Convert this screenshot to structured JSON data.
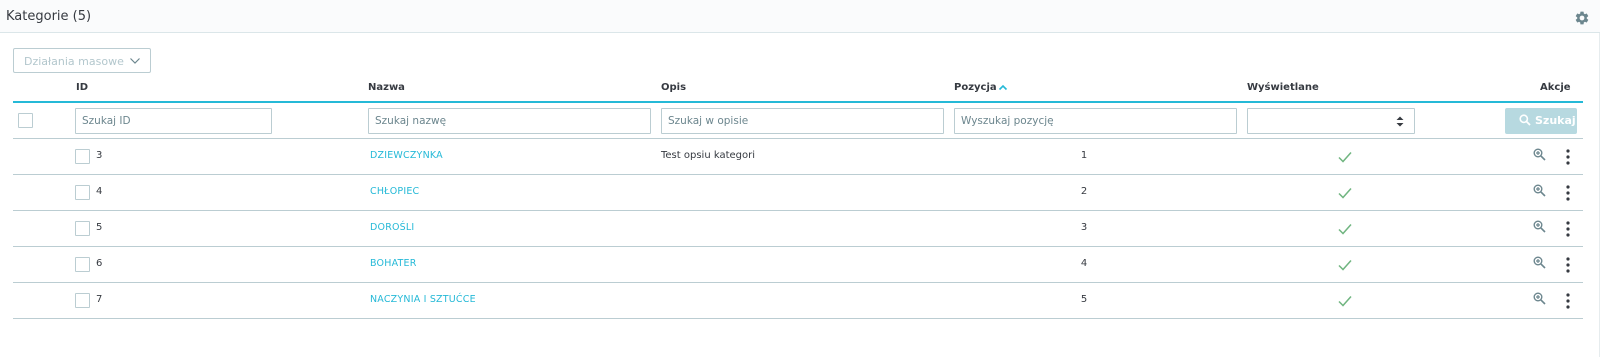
{
  "header": {
    "title": "Kategorie (5)",
    "settings_icon": "gear-icon"
  },
  "bulk_actions": {
    "label": "Działania masowe",
    "icon": "chevron-down-icon"
  },
  "table": {
    "columns": {
      "id": "ID",
      "name": "Nazwa",
      "description": "Opis",
      "position": "Pozycja",
      "displayed": "Wyświetlane",
      "actions": "Akcje"
    },
    "sort": {
      "column": "position",
      "direction": "ascending",
      "icon": "sort-up-icon"
    },
    "filters": {
      "id_placeholder": "Szukaj ID",
      "name_placeholder": "Szukaj nazwę",
      "description_placeholder": "Szukaj w opisie",
      "position_placeholder": "Wyszukaj pozycję",
      "displayed_selected": "",
      "search_button": "Szukaj"
    },
    "rows": [
      {
        "id": "3",
        "name": "DZIEWCZYNKA",
        "description": "Test opsiu kategori",
        "position": "1",
        "displayed": true
      },
      {
        "id": "4",
        "name": "CHŁOPIEC",
        "description": "",
        "position": "2",
        "displayed": true
      },
      {
        "id": "5",
        "name": "DOROŚLI",
        "description": "",
        "position": "3",
        "displayed": true
      },
      {
        "id": "6",
        "name": "BOHATER",
        "description": "",
        "position": "4",
        "displayed": true
      },
      {
        "id": "7",
        "name": "NACZYNIA I SZTUĆCE",
        "description": "",
        "position": "5",
        "displayed": true
      }
    ]
  },
  "colors": {
    "accent": "#25b9d7",
    "success": "#70b580",
    "border": "#bbcdd2",
    "text": "#363a41",
    "button_disabled": "#b7d9e0"
  }
}
